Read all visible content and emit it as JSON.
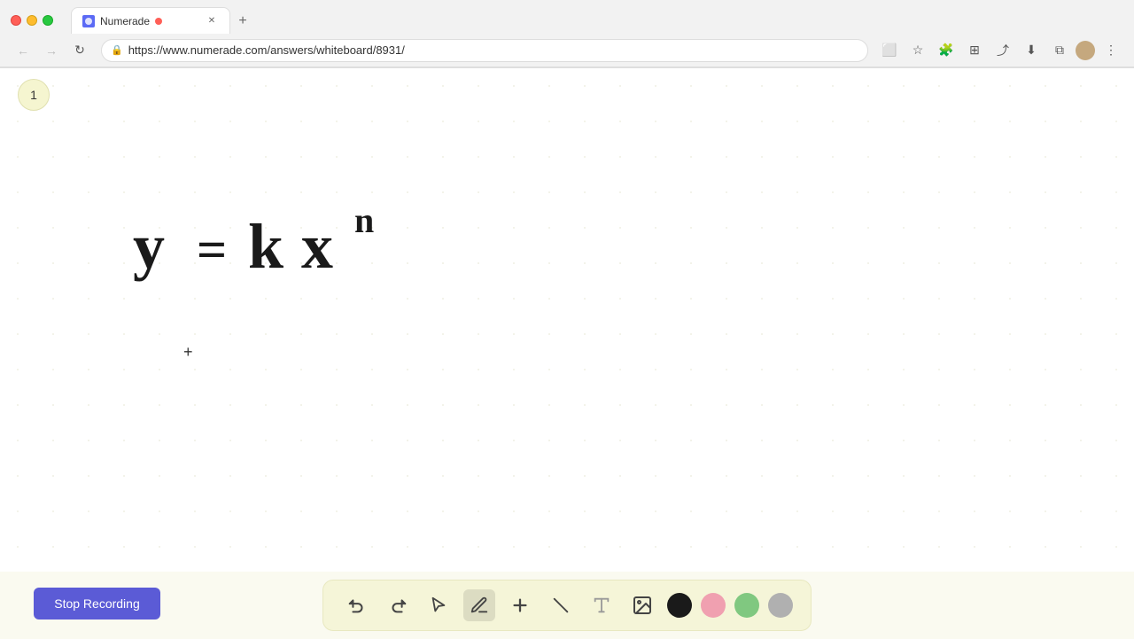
{
  "browser": {
    "tab_title": "Numerade",
    "tab_url": "https://www.numerade.com/answers/whiteboard/8931/",
    "new_tab_label": "+",
    "back_disabled": true,
    "forward_disabled": true
  },
  "toolbar": {
    "address": "https://www.numerade.com/answers/whiteboard/8931/"
  },
  "page": {
    "number": "1",
    "formula": "y = kx",
    "formula_sup": "n",
    "formula_display": "y = kxⁿ"
  },
  "drawing_tools": {
    "undo_label": "↺",
    "redo_label": "↻",
    "select_label": "↖",
    "pen_label": "✏",
    "add_label": "+",
    "eraser_label": "/",
    "text_label": "T",
    "image_label": "🖼"
  },
  "colors": {
    "black": "#1a1a1a",
    "pink": "#f0a0b0",
    "green": "#80c880",
    "gray": "#b0b0b0",
    "accent": "#5b5bd6"
  },
  "stop_recording_btn": "Stop Recording"
}
